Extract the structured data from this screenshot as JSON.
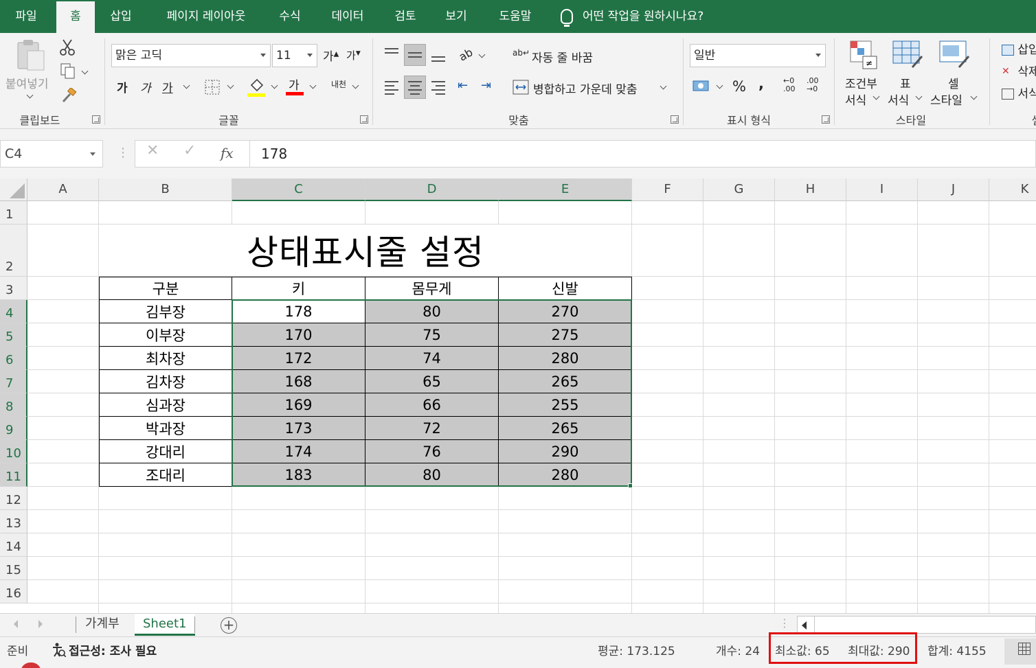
{
  "menu": {
    "tabs": [
      "파일",
      "홈",
      "삽입",
      "페이지 레이아웃",
      "수식",
      "데이터",
      "검토",
      "보기",
      "도움말"
    ],
    "active_tab": "홈",
    "tell_me": "어떤 작업을 원하시나요?"
  },
  "ribbon": {
    "clipboard": {
      "paste_label": "붙여넣기",
      "group": "클립보드"
    },
    "font": {
      "name": "맑은 고딕",
      "size": "11",
      "grow": "가",
      "shrink": "가",
      "bold": "가",
      "italic": "가",
      "underline": "가",
      "font_color_glyph": "가",
      "phonetic": "내천",
      "group": "글꼴",
      "fill_color": "#ffff00",
      "font_color": "#ff0000"
    },
    "alignment": {
      "wrap": "자동 줄 바꿈",
      "merge": "병합하고 가운데 맞춤",
      "group": "맞춤"
    },
    "number": {
      "format": "일반",
      "percent": "%",
      "comma": ",",
      "inc_decimal": "←0 .00",
      "dec_decimal": ".00 →0",
      "group": "표시 형식"
    },
    "styles": {
      "conditional": [
        "조건부",
        "서식"
      ],
      "table": [
        "표",
        "서식"
      ],
      "cell": [
        "셀",
        "스타일"
      ],
      "group": "스타일"
    },
    "cells": {
      "insert": "삽입",
      "delete": "삭제",
      "format": "서식",
      "group": "셀"
    }
  },
  "formula_bar": {
    "name_box": "C4",
    "fx": "fx",
    "value": "178"
  },
  "columns": [
    "A",
    "B",
    "C",
    "D",
    "E",
    "F",
    "G",
    "H",
    "I",
    "J",
    "K"
  ],
  "rows": [
    "1",
    "2",
    "3",
    "4",
    "5",
    "6",
    "7",
    "8",
    "9",
    "10",
    "11",
    "12",
    "13",
    "14",
    "15",
    "16"
  ],
  "sheet": {
    "title": "상태표시줄 설정",
    "headers": [
      "구분",
      "키",
      "몸무게",
      "신발"
    ],
    "data": [
      [
        "김부장",
        "178",
        "80",
        "270"
      ],
      [
        "이부장",
        "170",
        "75",
        "275"
      ],
      [
        "최차장",
        "172",
        "74",
        "280"
      ],
      [
        "김차장",
        "168",
        "65",
        "265"
      ],
      [
        "심과장",
        "169",
        "66",
        "255"
      ],
      [
        "박과장",
        "173",
        "72",
        "265"
      ],
      [
        "강대리",
        "174",
        "76",
        "290"
      ],
      [
        "조대리",
        "183",
        "80",
        "280"
      ]
    ]
  },
  "sheet_tabs": [
    "가계부",
    "Sheet1"
  ],
  "active_sheet": "Sheet1",
  "status": {
    "ready": "준비",
    "accessibility": "접근성: 조사 필요",
    "average": "평균: 173.125",
    "count": "개수: 24",
    "min": "최소값: 65",
    "max": "최대값: 290",
    "sum": "합계: 4155"
  },
  "colors": {
    "accent": "#217346",
    "highlight_box": "#e01010",
    "selection_fill": "#c8c8c8"
  }
}
